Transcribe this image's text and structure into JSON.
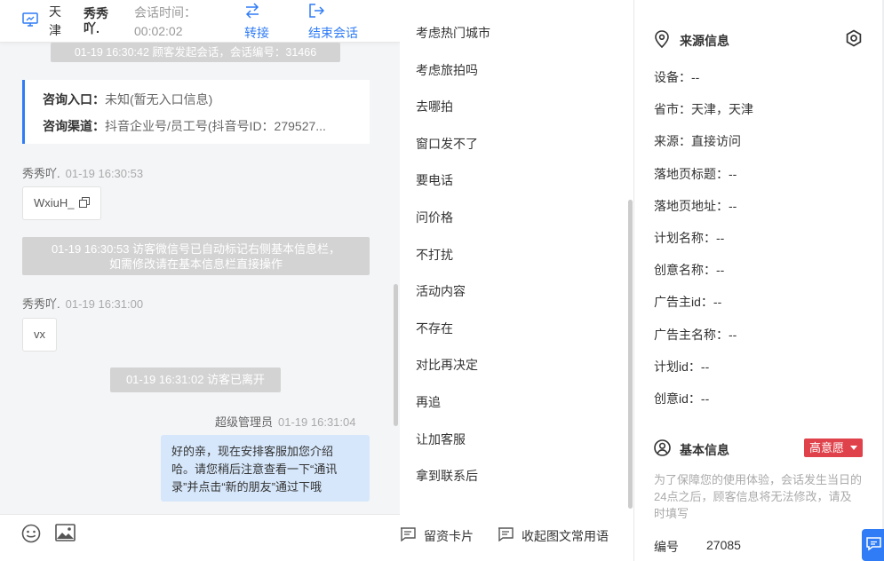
{
  "header": {
    "city": "天津",
    "visitor_name": "秀秀吖.",
    "time_label": "会话时间：",
    "time_value": "00:02:02",
    "transfer_label": "转接",
    "end_label": "结束会话"
  },
  "chat": {
    "session_start": "01-19 16:30:42 顾客发起会话，会话编号：31466",
    "entry_label": "咨询入口：",
    "entry_value": "未知(暂无入口信息)",
    "channel_label": "咨询渠道：",
    "channel_value": "抖音企业号/员工号(抖音号ID：279527...",
    "msg1_sender": "秀秀吖.",
    "msg1_time": "01-19 16:30:53",
    "msg1_text": "WxiuH_",
    "auto_tag_line1": "01-19 16:30:53 访客微信号已自动标记右侧基本信息栏，",
    "auto_tag_line2": "如需修改请在基本信息栏直接操作",
    "msg2_sender": "秀秀吖.",
    "msg2_time": "01-19 16:31:00",
    "msg2_text": "vx",
    "visitor_left": "01-19 16:31:02 访客已离开",
    "reply_sender": "超级管理员",
    "reply_time": "01-19 16:31:04",
    "reply_line1": "好的亲，现在安排客服加您介绍",
    "reply_line2": "哈。请您稍后注意查看一下“通讯",
    "reply_line3": "录”并点击“新的朋友”通过下哦"
  },
  "phrases": {
    "items": [
      "考虑热门城市",
      "考虑旅拍吗",
      "去哪拍",
      "窗口发不了",
      "要电话",
      "问价格",
      "不打扰",
      "活动内容",
      "不存在",
      "对比再决定",
      "再追",
      "让加客服",
      "拿到联系后"
    ],
    "card_label": "留资卡片",
    "collapse_label": "收起图文常用语"
  },
  "source": {
    "title": "来源信息",
    "fields": [
      {
        "label": "设备：",
        "value": "--"
      },
      {
        "label": "省市：",
        "value": "天津，天津"
      },
      {
        "label": "来源：",
        "value": "直接访问"
      },
      {
        "label": "落地页标题：",
        "value": "--"
      },
      {
        "label": "落地页地址：",
        "value": "--"
      },
      {
        "label": "计划名称：",
        "value": "--"
      },
      {
        "label": "创意名称：",
        "value": "--"
      },
      {
        "label": "广告主id：",
        "value": "--"
      },
      {
        "label": "广告主名称：",
        "value": "--"
      },
      {
        "label": "计划id：",
        "value": "--"
      },
      {
        "label": "创意id：",
        "value": "--"
      }
    ]
  },
  "basic": {
    "title": "基本信息",
    "intent": "高意愿",
    "notice": "为了保障您的使用体验，会话发生当日的24点之后，顾客信息将无法修改，请及时填写",
    "id_label": "编号",
    "id_value": "27085"
  },
  "colors": {
    "accent": "#2f7cf6",
    "badge": "#e0424b",
    "outgoing_bubble": "#d6e7fb",
    "system_msg": "#d3d3d3"
  },
  "icons": {
    "monitor": "monitor-icon",
    "transfer": "swap-arrows-icon",
    "end": "exit-icon",
    "copy": "copy-icon",
    "emoji": "emoji-icon",
    "image": "image-icon",
    "card": "message-card-icon",
    "location": "location-pin-icon",
    "settings": "gear-icon",
    "user": "user-circle-icon",
    "float_chat": "chat-bubble-icon"
  }
}
